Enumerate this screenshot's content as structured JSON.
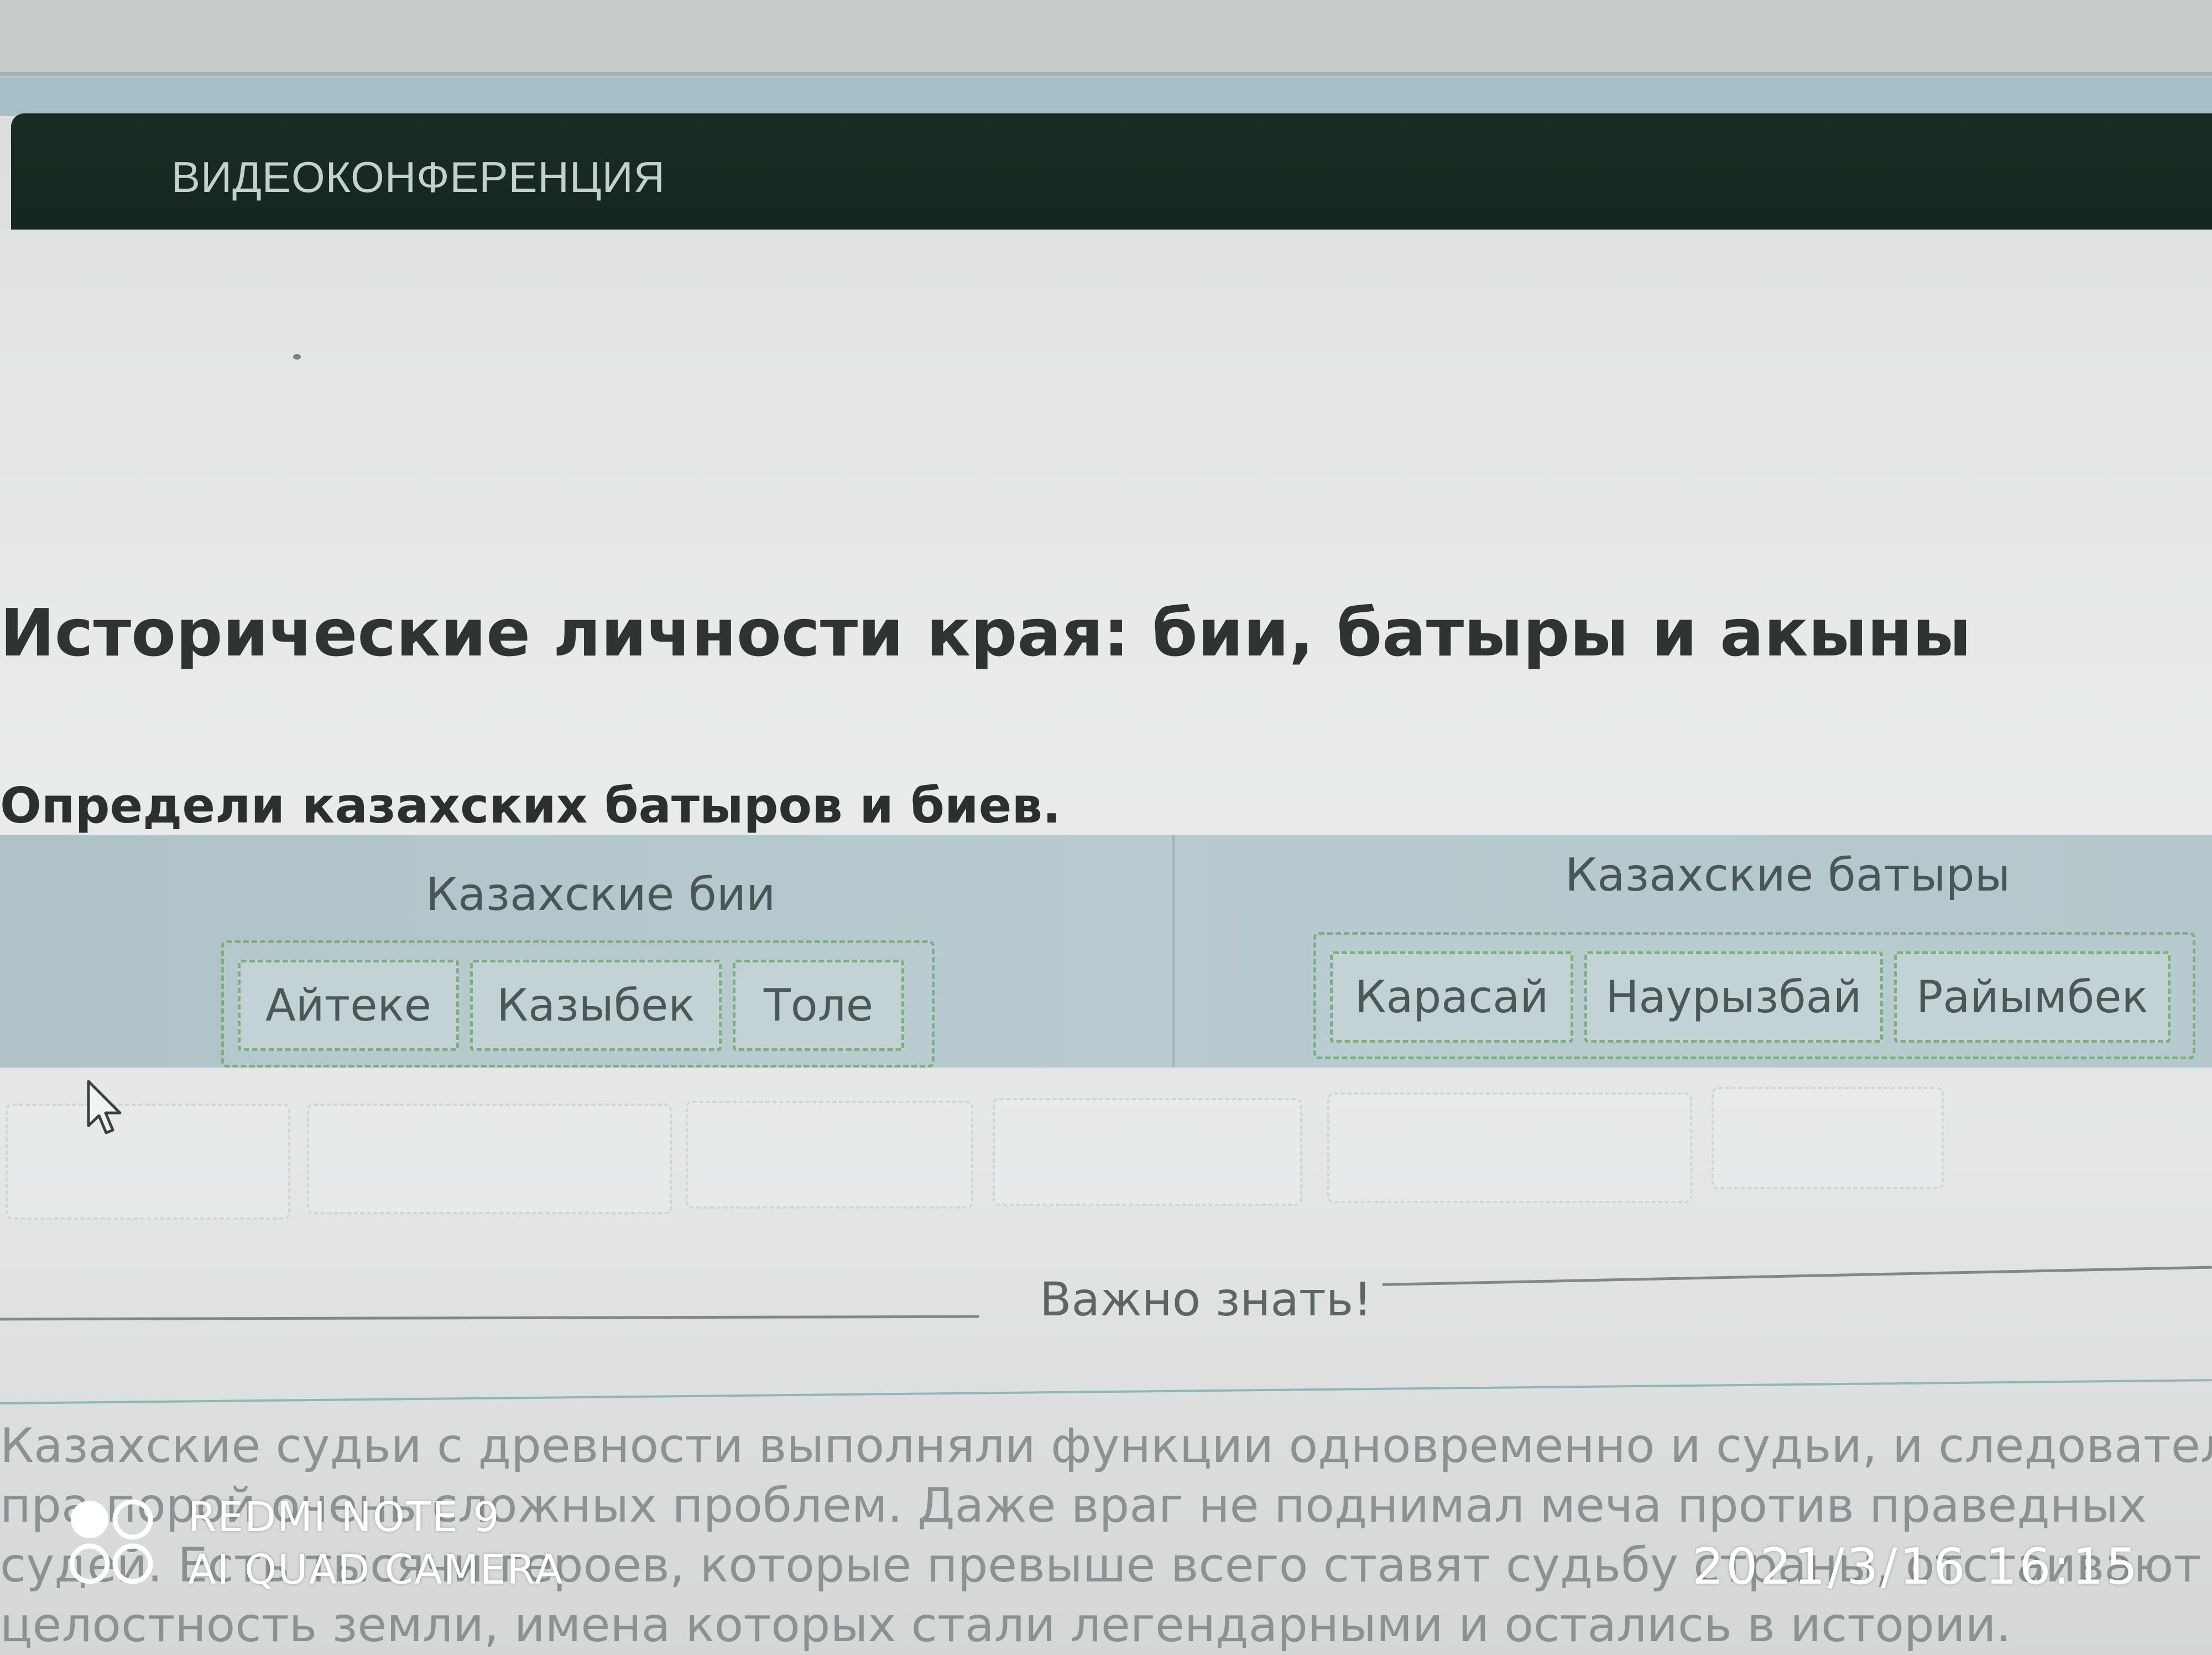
{
  "nav": {
    "title": "ВИДЕОКОНФЕРЕНЦИЯ"
  },
  "lesson": {
    "title": "Исторические личности края: бии, батыры и акыны",
    "task": "Определи казахских батыров и биев."
  },
  "categories": [
    {
      "title": "Казахские бии",
      "items": [
        "Айтеке",
        "Казыбек",
        "Толе"
      ]
    },
    {
      "title": "Казахские батыры",
      "items": [
        "Карасай",
        "Наурызбай",
        "Райымбек"
      ]
    }
  ],
  "important": {
    "heading": "Важно знать!",
    "lines": [
      "Казахские судьи с древности выполняли функции одновременно и судьи, и следователя. Судьи находил",
      "пра           порой очень сложных проблем. Даже враг не поднимал меча против праведных",
      "судей. Есть тысячи героев, которые превыше всего ставят судьбу страны, отстаивают целостность наци",
      "целостность земли, имена которых стали легендарными и остались в истории."
    ]
  },
  "camera_overlay": {
    "model": "REDMI NOTE 9",
    "camera": "AI QUAD CAMERA",
    "datetime": "2021/3/16  16:15"
  }
}
